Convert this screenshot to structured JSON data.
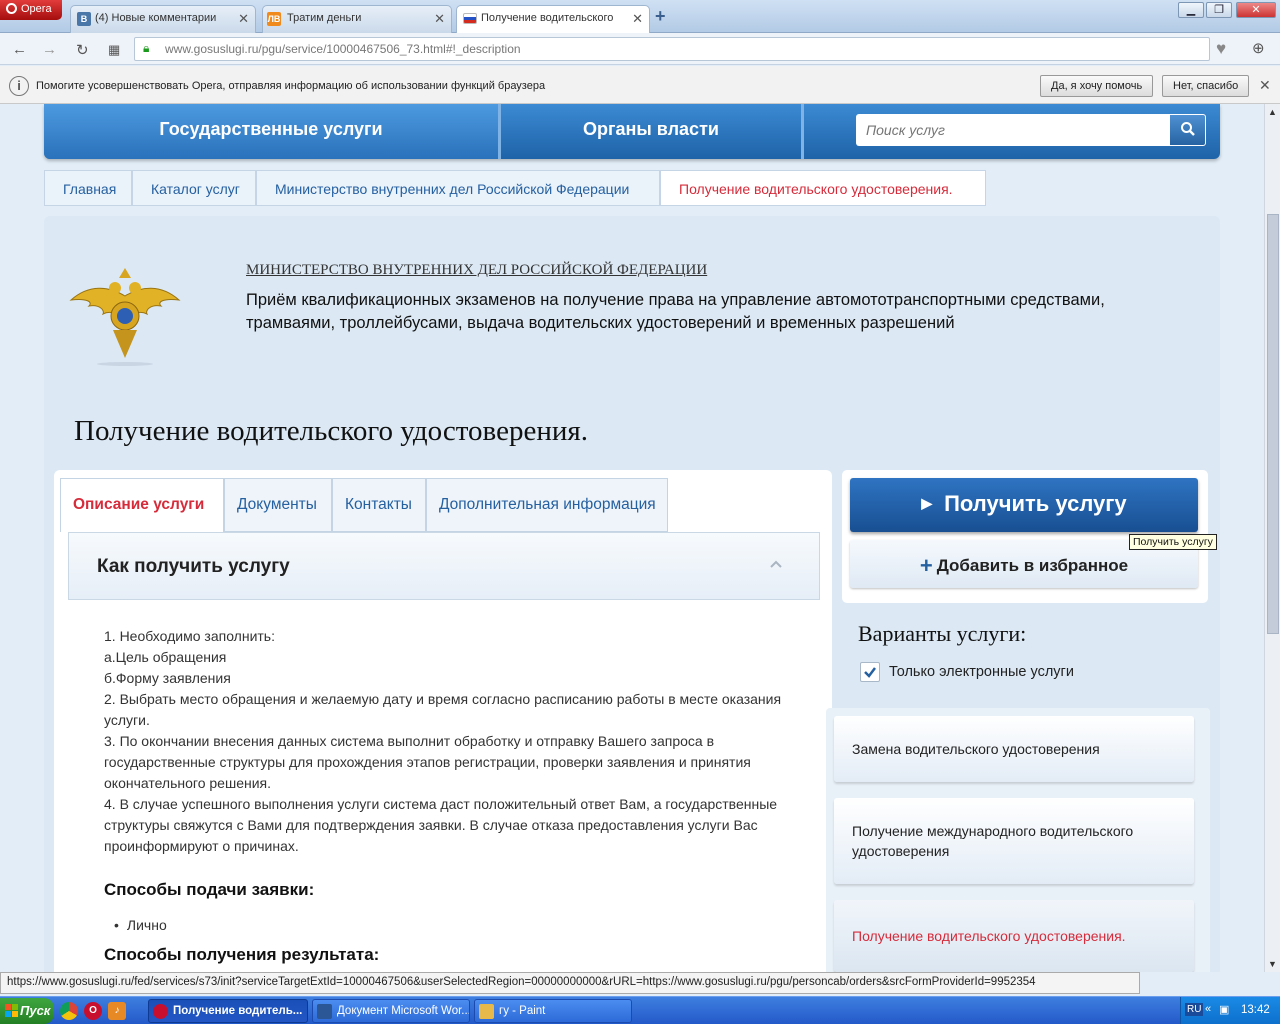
{
  "browser": {
    "menu_label": "Opera",
    "tabs": [
      {
        "label": "(4) Новые комментарии",
        "icon": "vk-icon"
      },
      {
        "label": "Тратим деньги",
        "icon": "lj-icon"
      },
      {
        "label": "Получение водительского",
        "icon": "russia-flag-icon"
      }
    ],
    "url": "www.gosuslugi.ru/pgu/service/10000467506_73.html#!_description",
    "infobar": {
      "text": "Помогите усовершенствовать Opera, отправляя информацию об использовании функций браузера",
      "accept": "Да, я хочу помочь",
      "decline": "Нет, спасибо"
    },
    "status_url": "https://www.gosuslugi.ru/fed/services/s73/init?serviceTargetExtId=10000467506&userSelectedRegion=00000000000&rURL=https://www.gosuslugi.ru/pgu/personcab/orders&srcFormProviderId=9952354"
  },
  "site": {
    "nav": {
      "services": "Государственные услуги",
      "authorities": "Органы власти",
      "search_placeholder": "Поиск услуг"
    },
    "breadcrumb": [
      "Главная",
      "Каталог услуг",
      "Министерство внутренних дел Российской Федерации",
      "Получение водительского удостоверения."
    ],
    "ministry": {
      "name": "МИНИСТЕРСТВО ВНУТРЕННИХ ДЕЛ РОССИЙСКОЙ ФЕДЕРАЦИИ",
      "description": "Приём квалификационных экзаменов на получение права на управление автомототранспортными средствами, трамваями, троллейбусами, выдача водительских удостоверений и временных разрешений"
    },
    "title": "Получение водительского удостоверения.",
    "tabs": [
      "Описание услуги",
      "Документы",
      "Контакты",
      "Дополнительная информация"
    ],
    "section": {
      "heading": "Как получить услугу",
      "steps": [
        "1. Необходимо заполнить:",
        "а.Цель обращения",
        "б.Форму заявления",
        "2. Выбрать место обращения и желаемую дату и время согласно расписанию работы в месте оказания услуги.",
        "3. По окончании внесения данных система выполнит обработку и отправку Вашего запроса в государственные структуры для прохождения этапов регистрации, проверки заявления и принятия окончательного решения.",
        "4. В случае успешного выполнения услуги система даст положительный ответ Вам, а государственные структуры свяжутся с Вами для подтверждения заявки. В случае отказа предоставления услуги Вас проинформируют о причинах."
      ],
      "submit_heading": "Способы подачи заявки:",
      "submit_methods": [
        "Лично"
      ],
      "result_heading": "Способы получения результата:"
    },
    "actions": {
      "get_service": "Получить услугу",
      "tooltip": "Получить услугу",
      "add_favorite": "Добавить в избранное"
    },
    "variants": {
      "title": "Варианты услуги:",
      "only_electronic": "Только электронные услуги",
      "only_electronic_checked": true,
      "items": [
        "Замена водительского удостоверения",
        "Получение международного водительского удостоверения",
        "Получение водительского удостоверения."
      ]
    }
  },
  "taskbar": {
    "start": "Пуск",
    "tasks": [
      "Получение водитель...",
      "Документ Microsoft Wor...",
      "гу - Paint"
    ],
    "lang": "RU",
    "clock": "13:42"
  },
  "colors": {
    "accent_blue": "#1e63a8",
    "current_red": "#d62b3a"
  }
}
